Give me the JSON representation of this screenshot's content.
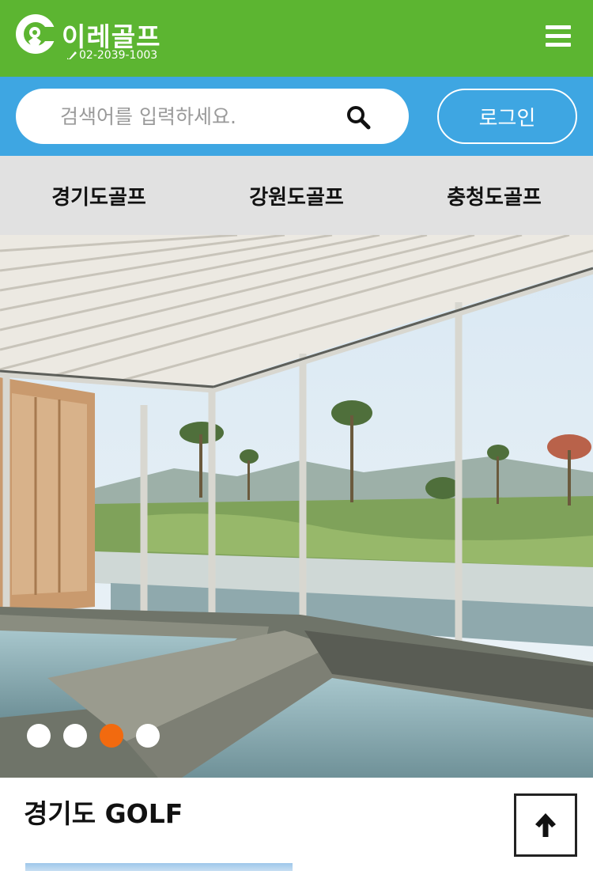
{
  "header": {
    "brand_name": "이레골프",
    "phone": "02-2039-1003",
    "logo_icon": "golf-c-logo-icon",
    "menu_icon": "hamburger-menu-icon",
    "colors": {
      "header_bg": "#5cb531"
    }
  },
  "search": {
    "placeholder": "검색어를 입력하세요.",
    "value": "",
    "search_icon": "search-icon",
    "login_label": "로그인",
    "colors": {
      "bar_bg": "#3ea6e2"
    }
  },
  "nav": {
    "tabs": [
      {
        "label": "경기도골프"
      },
      {
        "label": "강원도골프"
      },
      {
        "label": "충청도골프"
      }
    ],
    "colors": {
      "nav_bg": "#e1e1e1"
    }
  },
  "slider": {
    "slide_count": 4,
    "active_index": 3,
    "colors": {
      "active_dot": "#f26a0f",
      "inactive_dot": "#ffffff"
    }
  },
  "section": {
    "title": "경기도 GOLF",
    "top_button_icon": "arrow-up-icon"
  }
}
